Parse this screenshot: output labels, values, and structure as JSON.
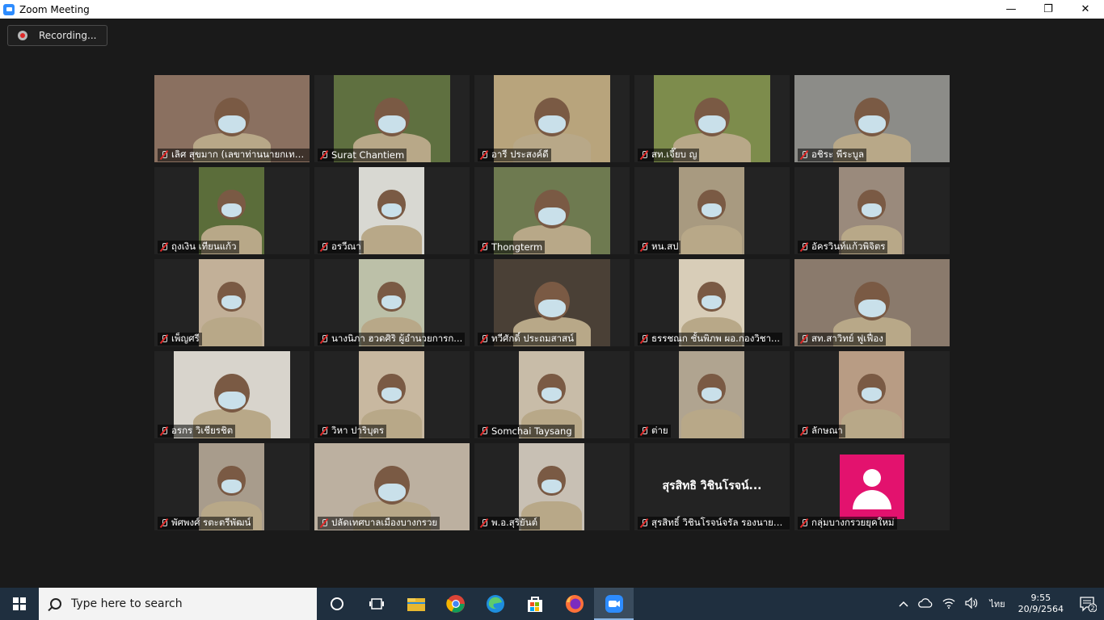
{
  "window": {
    "title": "Zoom Meeting"
  },
  "recording": {
    "label": "Recording..."
  },
  "participants": [
    {
      "name": "เลิศ สุขมาก (เลขาท่านนายกเทศ...",
      "bg": "#8a7060",
      "vx": 0,
      "vw": 192
    },
    {
      "name": "Surat Chantiem",
      "bg": "#5f7040",
      "vx": 24,
      "vw": 144
    },
    {
      "name": "อารี ประสงค์ดี",
      "bg": "#b8a47c",
      "vx": 24,
      "vw": 144
    },
    {
      "name": "สท.เจี๊ยบ ญ",
      "bg": "#7d8c4c",
      "vx": 24,
      "vw": 144
    },
    {
      "name": "อชิระ พีระบูล",
      "bg": "#8c8c88",
      "vx": 0,
      "vw": 192
    },
    {
      "name": "ถุงเงิน เทียนแก้ว",
      "bg": "#5b6d3a",
      "vx": 55,
      "vw": 81
    },
    {
      "name": "อรวีณา",
      "bg": "#d8d8d2",
      "vx": 55,
      "vw": 81
    },
    {
      "name": "Thongterm",
      "bg": "#6e7a50",
      "vx": 24,
      "vw": 144
    },
    {
      "name": "หน.สป",
      "bg": "#a89a80",
      "vx": 55,
      "vw": 81
    },
    {
      "name": "อัครวินท์แก้วพิจิตร",
      "bg": "#9a8a7c",
      "vx": 55,
      "vw": 81
    },
    {
      "name": "เพ็ญศรี",
      "bg": "#c2b098",
      "vx": 55,
      "vw": 81
    },
    {
      "name": "นางนิภา ฮวดศิริ  ผู้อำนวยการก...",
      "bg": "#bcc0a8",
      "vx": 55,
      "vw": 81
    },
    {
      "name": "ทวีศักดิ์ ประถมสาสน์",
      "bg": "#4a4036",
      "vx": 24,
      "vw": 144
    },
    {
      "name": "ธรรชณก ชั้นพิภพ ผอ.กองวิชา...",
      "bg": "#d8cdb8",
      "vx": 55,
      "vw": 81
    },
    {
      "name": "สท.สาวิทย์  ฟูเฟื่อง",
      "bg": "#8a7a6c",
      "vx": 0,
      "vw": 192
    },
    {
      "name": "อรกร วิเชียรชิต",
      "bg": "#d8d4cc",
      "vx": 24,
      "vw": 144
    },
    {
      "name": "วิหา ปาริบุตร",
      "bg": "#c8b8a0",
      "vx": 55,
      "vw": 81
    },
    {
      "name": "Somchai Taysang",
      "bg": "#c8bca8",
      "vx": 55,
      "vw": 81
    },
    {
      "name": "ต่าย",
      "bg": "#b0a490",
      "vx": 55,
      "vw": 81
    },
    {
      "name": "ลักษณา",
      "bg": "#b89c84",
      "vx": 55,
      "vw": 81
    },
    {
      "name": "พัศพงศ์  รตะตรีพัฒน์",
      "bg": "#a89c8c",
      "vx": 55,
      "vw": 81
    },
    {
      "name": "ปลัดเทศบาลเมืองบางกรวย",
      "bg": "#bcb0a0",
      "vx": 0,
      "vw": 192
    },
    {
      "name": "พ.อ.สุริยันต์",
      "bg": "#c8c0b4",
      "vx": 55,
      "vw": 81
    },
    {
      "name": "สุรสิทธิ์ วิชินโรจน์จรัล รองนายก...",
      "display_name": "สุรสิทธิ วิชินโรจน์...",
      "video_off": true
    },
    {
      "name": "กลุ่มบางกรวยยุคใหม่",
      "avatar": true,
      "avatar_color": "#e3126e"
    }
  ],
  "taskbar": {
    "search_placeholder": "Type here to search",
    "language": "ไทย",
    "time": "9:55",
    "date": "20/9/2564",
    "notifications": "2"
  }
}
